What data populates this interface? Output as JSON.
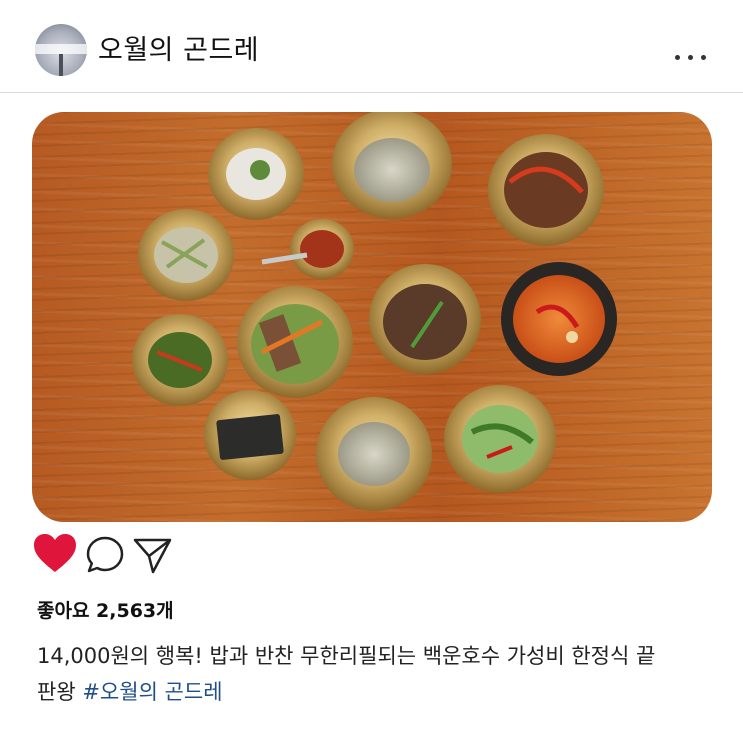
{
  "post": {
    "username": "오월의 곤드레",
    "likes_text": "좋아요 2,563개",
    "caption_line1": "14,000원의 행복! 밥과 반찬 무한리필되는 백운호수 가성비 한정식 끝",
    "caption_line2": "판왕",
    "hashtag": "#오월의 곤드레",
    "liked": true
  },
  "icons": {
    "more": "more-dots-icon",
    "like": "heart-icon",
    "comment": "comment-bubble-icon",
    "share": "send-icon"
  },
  "colors": {
    "heart": "#e0153b",
    "hashtag": "#1f4f8b",
    "wood": "#bf652a"
  }
}
